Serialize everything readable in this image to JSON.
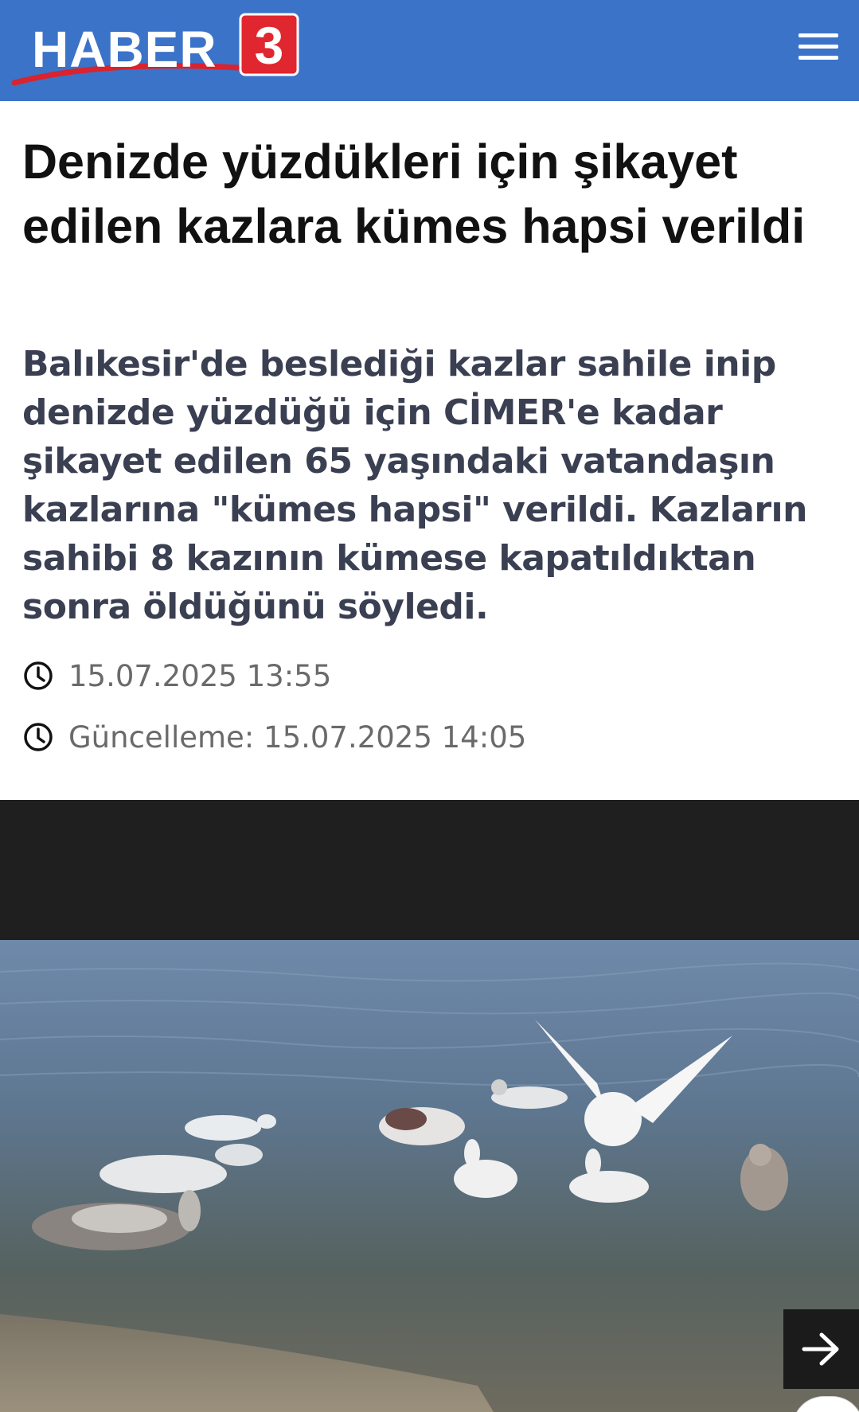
{
  "header": {
    "logo_text": "HABER",
    "logo_number": "3",
    "menu_icon": "hamburger-menu-icon",
    "background_color": "#3b73c8"
  },
  "article": {
    "headline": "Denizde yüzdükleri için şikayet edilen kazlara kümes hapsi verildi",
    "summary": "Balıkesir'de beslediği kazlar sahile inip denizde yüzdüğü için CİMER'e kadar şikayet edilen 65 yaşındaki vatandaşın kazlarına \"kümes hapsi\" verildi. Kazların sahibi 8 kazının kümese kapatıldıktan sonra öldüğünü söyledi.",
    "published": "15.07.2025 13:55",
    "updated": "Güncelleme: 15.07.2025 14:05"
  },
  "media": {
    "next_icon": "arrow-right-icon"
  }
}
